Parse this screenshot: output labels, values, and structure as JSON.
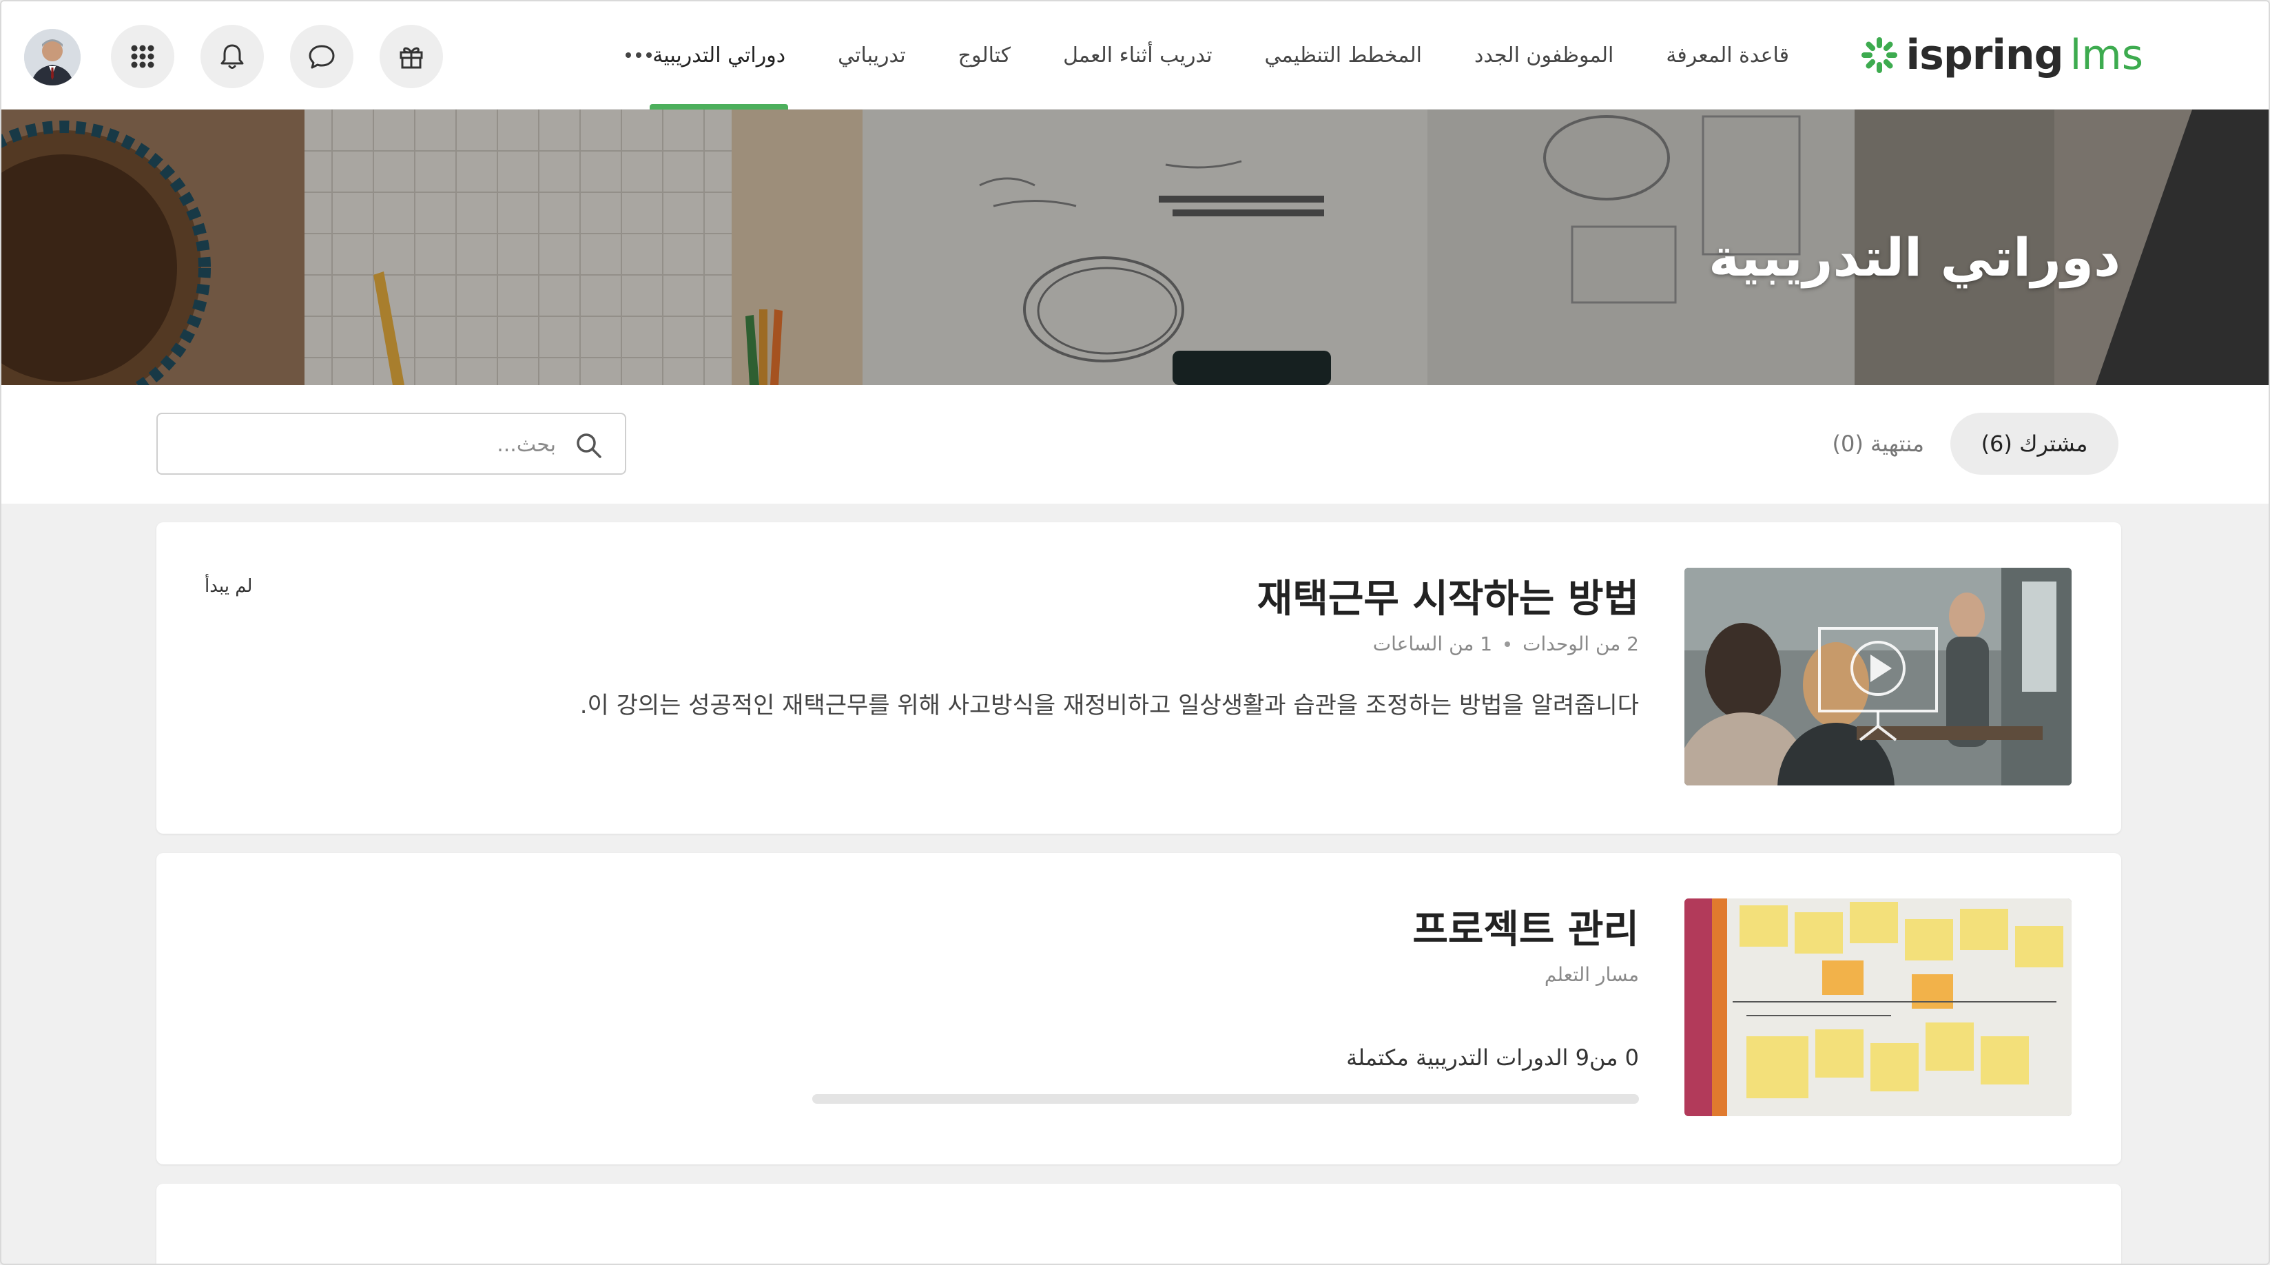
{
  "header": {
    "logo": {
      "word": "ispring",
      "suffix": "lms",
      "brand_color": "#3dab4f"
    },
    "nav": [
      {
        "label": "دوراتي التدريبية",
        "active": true
      },
      {
        "label": "تدريباتي",
        "active": false
      },
      {
        "label": "كتالوج",
        "active": false
      },
      {
        "label": "تدريب أثناء العمل",
        "active": false
      },
      {
        "label": "المخطط التنظيمي",
        "active": false
      },
      {
        "label": "الموظفون الجدد",
        "active": false
      },
      {
        "label": "قاعدة المعرفة",
        "active": false
      }
    ],
    "icons": [
      "more-icon",
      "gift-icon",
      "chat-icon",
      "bell-icon",
      "apps-grid-icon",
      "user-avatar"
    ]
  },
  "banner": {
    "title": "دوراتي التدريبية"
  },
  "filters": {
    "tabs": [
      {
        "label": "مشترك (6)",
        "active": true
      },
      {
        "label": "منتهية (0)",
        "active": false
      }
    ],
    "search": {
      "placeholder": "بحث...",
      "value": ""
    }
  },
  "courses": [
    {
      "title": "재택근무 시작하는 방법",
      "meta_hours": "1 من الساعات",
      "meta_modules": "2 من الوحدات",
      "description": ".이 강의는 성공적인 재택근무를 위해 사고방식을 재정비하고 일상생활과 습관을 조정하는 방법을 알려줍니다",
      "status": "لم يبدأ",
      "thumbnail": "video-presentation-thumbnail"
    },
    {
      "title": "프로젝트 관리",
      "type": "مسار التعلم",
      "progress_text": "0 من9 الدورات التدريبية مكتملة",
      "progress_fraction": 0,
      "thumbnail": "sticky-notes-board-thumbnail"
    }
  ],
  "colors": {
    "accent": "#4caf5c",
    "page_bg": "#efefef"
  }
}
